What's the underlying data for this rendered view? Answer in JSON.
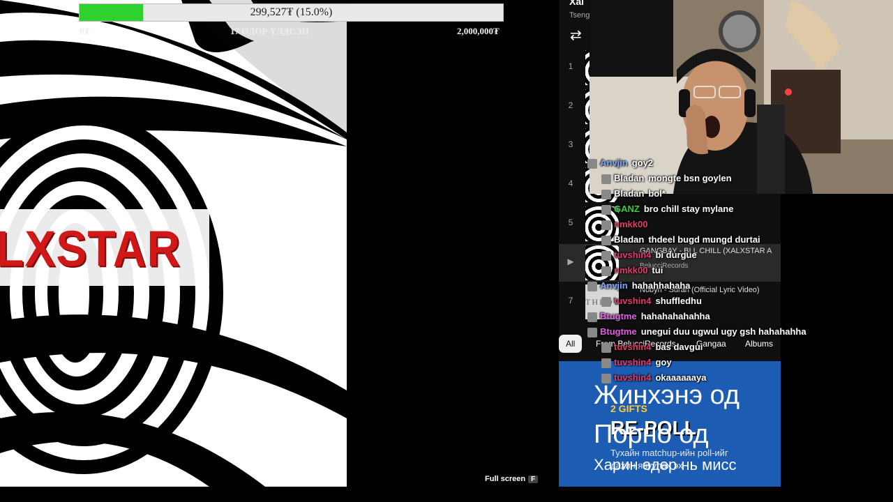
{
  "goal": {
    "amount_text": "299,527₮ (15.0%)",
    "progress_percent": 15.0,
    "min_label": "0₮",
    "days_label": "17 ӨДӨР ҮЛДСЭН",
    "max_label": "2,000,000₮",
    "fill_color": "#2fd12f"
  },
  "video": {
    "brand_text": "LXSTAR",
    "fullscreen_label": "Full screen",
    "fullscreen_key": "F"
  },
  "youtube": {
    "title": "Xal",
    "subtitle": "Tseng",
    "loop_icon": "loop-icon",
    "playlist": [
      {
        "num": "1"
      },
      {
        "num": "2"
      },
      {
        "num": "3"
      },
      {
        "num": "4"
      },
      {
        "num": "5"
      },
      {
        "num": "▶"
      },
      {
        "num": "7"
      }
    ],
    "overlay_lines": [
      "GANGBAY - BI L CHILL (XALXSTAR A",
      "BelucciRecords",
      "Nobyn - Surah (Official Lyric Video)"
    ],
    "thumb7_text": "THROUG",
    "chips": [
      "All",
      "From BelucciRecords",
      "Gangaa",
      "Albums"
    ],
    "card": {
      "line1": "Жинхэнэ од",
      "gifts": "2 GIFTS",
      "repoll": "RE-POLL",
      "line2": "Порно од",
      "small1": "Тухайн matchup-ийн poll-ийг",
      "small2": "дахин явуулах эх",
      "line3": "Харин өдөр нь мисс"
    }
  },
  "chat": {
    "messages": [
      {
        "user": "Anvjin",
        "text": "goy2",
        "color": "#7aa7ff"
      },
      {
        "user": "Bladan",
        "text": "mongte bsn goylen",
        "color": "#ffffff"
      },
      {
        "user": "Bladan",
        "text": "bol*",
        "color": "#ffffff"
      },
      {
        "user": "GANZ",
        "text": "bro chill stay mylane",
        "color": "#3bd13b"
      },
      {
        "user": "nmkk00",
        "text": "",
        "color": "#e23b6b"
      },
      {
        "user": "Bladan",
        "text": "thdeel bugd mungd durtai",
        "color": "#ffffff"
      },
      {
        "user": "tuvshin4",
        "text": "bi durgue",
        "color": "#e23b6b"
      },
      {
        "user": "nmkk00",
        "text": "tui",
        "color": "#e23b6b"
      },
      {
        "user": "Anvjin",
        "text": "hahahhahaha",
        "color": "#7aa7ff"
      },
      {
        "user": "tuvshin4",
        "text": "shuffledhu",
        "color": "#e23b6b"
      },
      {
        "user": "Btugtme",
        "text": "hahahahahahha",
        "color": "#e55ce5"
      },
      {
        "user": "Btugtme",
        "text": "unegui duu ugwul ugy gsh hahahahha",
        "color": "#e55ce5"
      },
      {
        "user": "tuvshin4",
        "text": "bas davgui",
        "color": "#e23b6b"
      },
      {
        "user": "tuvshin4",
        "text": "goy",
        "color": "#e23b6b"
      },
      {
        "user": "tuvshin4",
        "text": "okaaaaaaya",
        "color": "#e23b6b"
      }
    ]
  }
}
